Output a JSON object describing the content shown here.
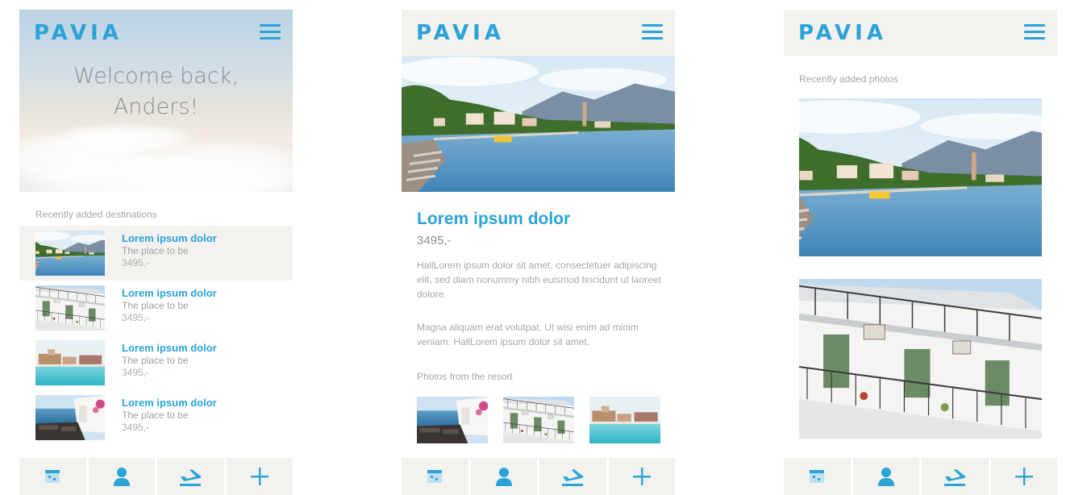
{
  "brand": {
    "logo_text": "PAVIA",
    "accent": "#2aa3d9",
    "nav_bg": "#f4f2ee"
  },
  "screens": [
    {
      "hero": {
        "welcome_line1": "Welcome back,",
        "welcome_line2": "Anders!"
      },
      "section_label": "Recently added destinations",
      "destinations": [
        {
          "title": "Lorem ipsum dolor",
          "subtitle": "The place to be",
          "price": "3495,-",
          "thumb": "lake-thumb"
        },
        {
          "title": "Lorem ipsum dolor",
          "subtitle": "The place to be",
          "price": "3495,-",
          "thumb": "building-thumb"
        },
        {
          "title": "Lorem ipsum dolor",
          "subtitle": "The place to be",
          "price": "3495,-",
          "thumb": "pool-thumb"
        },
        {
          "title": "Lorem ipsum dolor",
          "subtitle": "The place to be",
          "price": "3495,-",
          "thumb": "sea-terrace-thumb"
        }
      ]
    },
    {
      "title": "Lorem ipsum dolor",
      "price": "3495,-",
      "paragraph1": "HallLorem ipsum dolor sit amet, consectetuer adipiscing elit, sed diam nonummy nibh euismod tincidunt ut laoreet dolore.",
      "paragraph2": "Magna aliquam erat volutpat. Ut wisi enim ad minim veniam. HallLorem ipsum dolor sit amet.",
      "section_label": "Photos from the resort"
    },
    {
      "section_label": "Recently added photos"
    }
  ],
  "bottom_nav": [
    {
      "icon": "calendar-icon"
    },
    {
      "icon": "user-icon"
    },
    {
      "icon": "plane-icon"
    },
    {
      "icon": "plus-icon"
    }
  ]
}
